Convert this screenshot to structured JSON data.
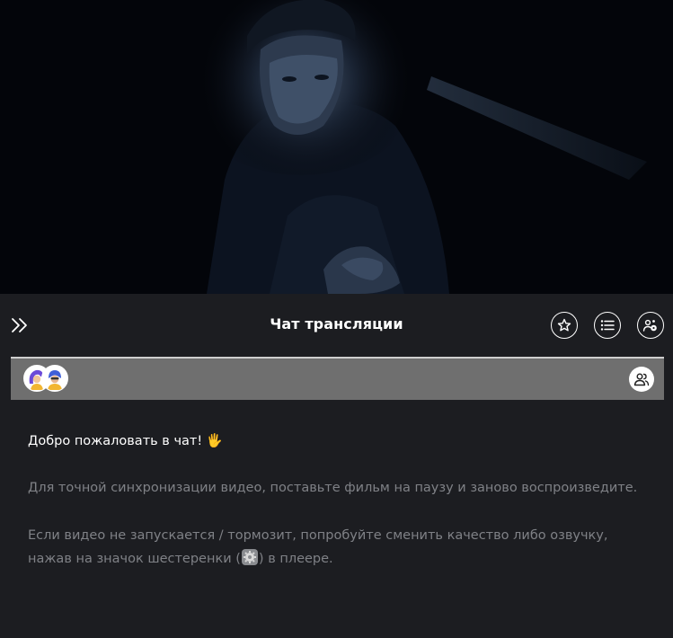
{
  "video": {
    "scene": "dark-still-frame"
  },
  "chat": {
    "title": "Чат трансляции",
    "buttons": {
      "collapse": "double-chevron-right-icon",
      "favorite": "star-icon",
      "list": "list-icon",
      "settings": "user-settings-icon"
    }
  },
  "participants": {
    "avatars": [
      "avatar-purple-hair",
      "avatar-blue-hair"
    ],
    "users_button": "users-icon"
  },
  "messages": {
    "welcome_text": "Добро пожаловать в чат!",
    "welcome_emoji": "🖐",
    "hint_sync": "Для точной синхронизации видео, поставьте фильм на паузу и заново воспроизведите.",
    "hint_quality_before": "Если видео не запускается / тормозит, попробуйте сменить качество либо озвучку, нажав на значок шестеренки (",
    "hint_quality_after": ") в плеере."
  },
  "colors": {
    "background": "#1c1d21",
    "participants_bar": "#6f6f6f",
    "muted_text": "#7f8186"
  }
}
